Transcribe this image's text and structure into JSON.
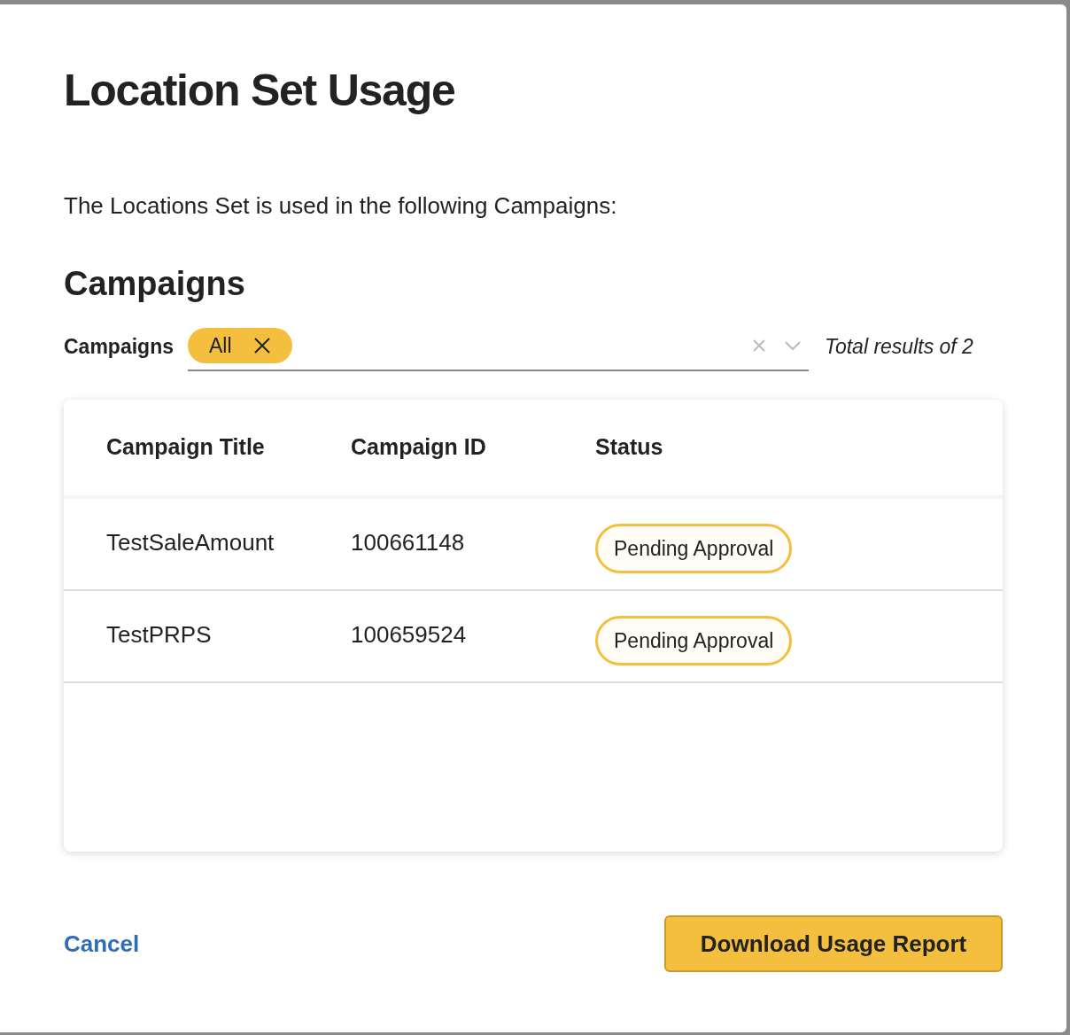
{
  "dialog": {
    "title": "Location Set Usage",
    "description": "The Locations Set is used in the following Campaigns:",
    "section_title": "Campaigns"
  },
  "filter": {
    "label": "Campaigns",
    "chips": [
      {
        "label": "All"
      }
    ],
    "total": "Total results of 2"
  },
  "table": {
    "columns": [
      "Campaign Title",
      "Campaign ID",
      "Status"
    ],
    "rows": [
      {
        "title": "TestSaleAmount",
        "id": "100661148",
        "status": "Pending Approval"
      },
      {
        "title": "TestPRPS",
        "id": "100659524",
        "status": "Pending Approval"
      }
    ]
  },
  "buttons": {
    "cancel": "Cancel",
    "primary": "Download Usage Report"
  }
}
